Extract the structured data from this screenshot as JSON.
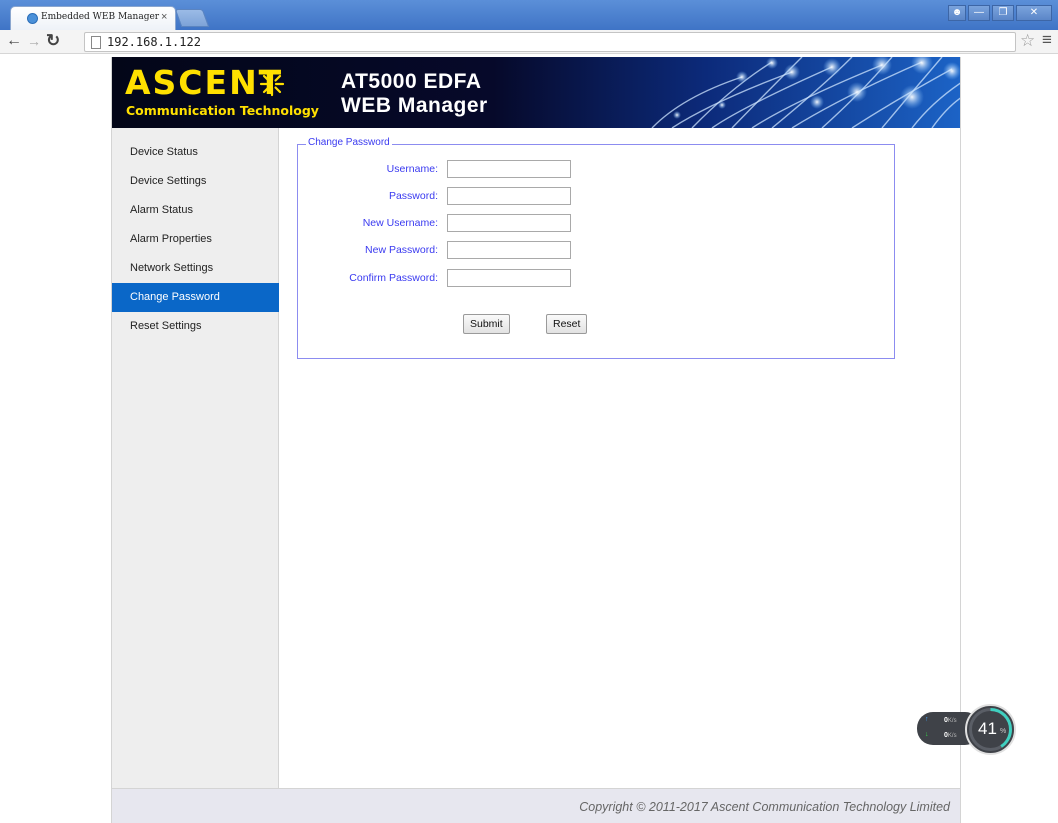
{
  "browser": {
    "tab_title": "Embedded WEB Manager",
    "tab_close": "×",
    "url": "192.168.1.122"
  },
  "banner": {
    "logo_main": "ASCENT",
    "logo_sub": "Communication Technology",
    "product_line1": "AT5000 EDFA",
    "product_line2": "WEB Manager",
    "logo_color": "#ffe000"
  },
  "sidebar": {
    "items": [
      {
        "label": "Device Status"
      },
      {
        "label": "Device Settings"
      },
      {
        "label": "Alarm Status"
      },
      {
        "label": "Alarm Properties"
      },
      {
        "label": "Network Settings"
      },
      {
        "label": "Change Password"
      },
      {
        "label": "Reset Settings"
      }
    ],
    "active_item": "Change Password",
    "active_color": "#0a67c8"
  },
  "form": {
    "legend": "Change Password",
    "fields": [
      {
        "label": "Username:",
        "value": ""
      },
      {
        "label": "Password:",
        "value": ""
      },
      {
        "label": "New Username:",
        "value": ""
      },
      {
        "label": "New Password:",
        "value": ""
      },
      {
        "label": "Confirm Password:",
        "value": ""
      }
    ],
    "submit_label": "Submit",
    "reset_label": "Reset",
    "label_color": "#3a3af0"
  },
  "footer": {
    "copyright": "Copyright © 2011-2017 Ascent Communication Technology Limited"
  },
  "net_widget": {
    "upload": "0",
    "download": "0",
    "unit": "K/s",
    "percent": "41",
    "percent_sign": "%",
    "percent_value": 41
  }
}
